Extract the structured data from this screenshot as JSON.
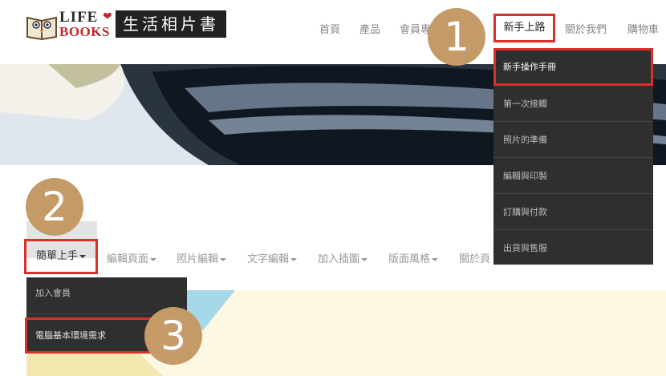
{
  "brand": {
    "logo_line1": "LIFE",
    "logo_line2": "BOOKS",
    "title": "生活相片書"
  },
  "nav": {
    "items": [
      "首頁",
      "產品",
      "會員專",
      "新手上路",
      "關於我們",
      "購物車"
    ]
  },
  "dropdown_main": {
    "items": [
      "新手操作手冊",
      "第一次接觸",
      "照片的準備",
      "編輯與印製",
      "訂購與付款",
      "出貨與售服"
    ]
  },
  "subnav": {
    "items": [
      "簡單上手",
      "編輯頁面",
      "照片編輯",
      "文字編輯",
      "加入插圖",
      "版面風格",
      "關於頁"
    ]
  },
  "dropdown_sub": {
    "items": [
      "加入會員",
      "電腦基本環境需求"
    ]
  },
  "steps": [
    "1",
    "2",
    "3"
  ],
  "colors": {
    "highlight": "#d9302c",
    "step_marker": "#c49a66",
    "dropdown_bg": "#2f2f2f"
  }
}
